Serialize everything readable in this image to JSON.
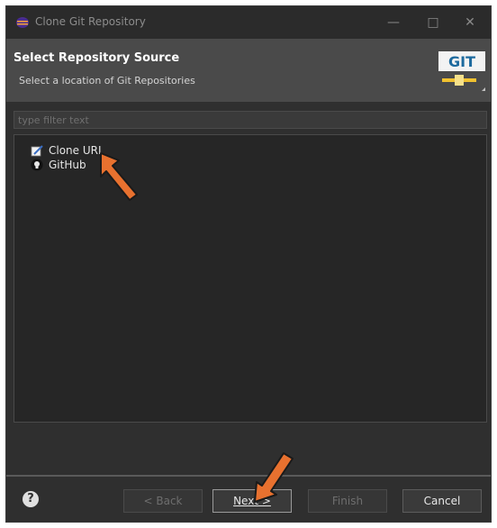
{
  "window": {
    "title": "Clone Git Repository"
  },
  "banner": {
    "title": "Select Repository Source",
    "description": "Select a location of Git Repositories",
    "logo_text": "GIT"
  },
  "filter": {
    "placeholder": "type filter text"
  },
  "items": [
    {
      "label": "Clone URI"
    },
    {
      "label": "GitHub"
    }
  ],
  "buttons": {
    "back": "< Back",
    "next": "Next >",
    "finish": "Finish",
    "cancel": "Cancel"
  },
  "colors": {
    "annotation_arrow": "#e8712f"
  }
}
